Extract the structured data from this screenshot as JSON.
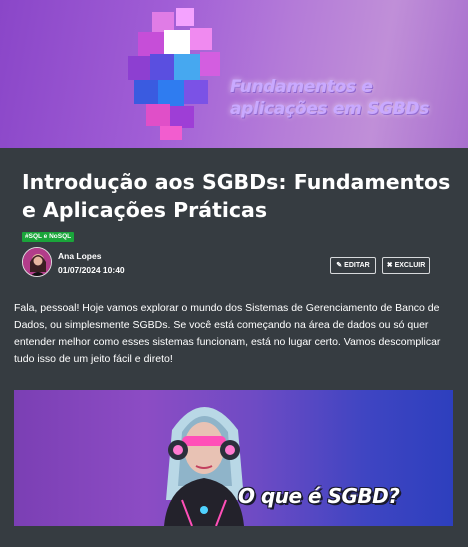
{
  "hero": {
    "banner_text": "Fundamentos e aplicações em SGBDs",
    "icon": "data-cubes-illustration"
  },
  "article": {
    "title": "Introdução aos SGBDs: Fundamentos e Aplicações Práticas",
    "tag": "#SQL e NoSQL",
    "author": {
      "name": "Ana Lopes",
      "date": "01/07/2024 10:40"
    },
    "actions": {
      "edit_label": "EDITAR",
      "delete_label": "EXCLUIR"
    },
    "intro": "Fala, pessoal! Hoje vamos explorar o mundo dos Sistemas de Gerenciamento de Banco de Dados, ou simplesmente SGBDs. Se você está começando na área de dados ou só quer entender melhor como esses sistemas funcionam, está no lugar certo. Vamos descomplicar tudo isso de um jeito fácil e direto!",
    "image_banner": {
      "text": "O que é SGBD?"
    }
  },
  "colors": {
    "background": "#363c41",
    "tag": "#1aa53a",
    "hero": "#a15ed6"
  }
}
